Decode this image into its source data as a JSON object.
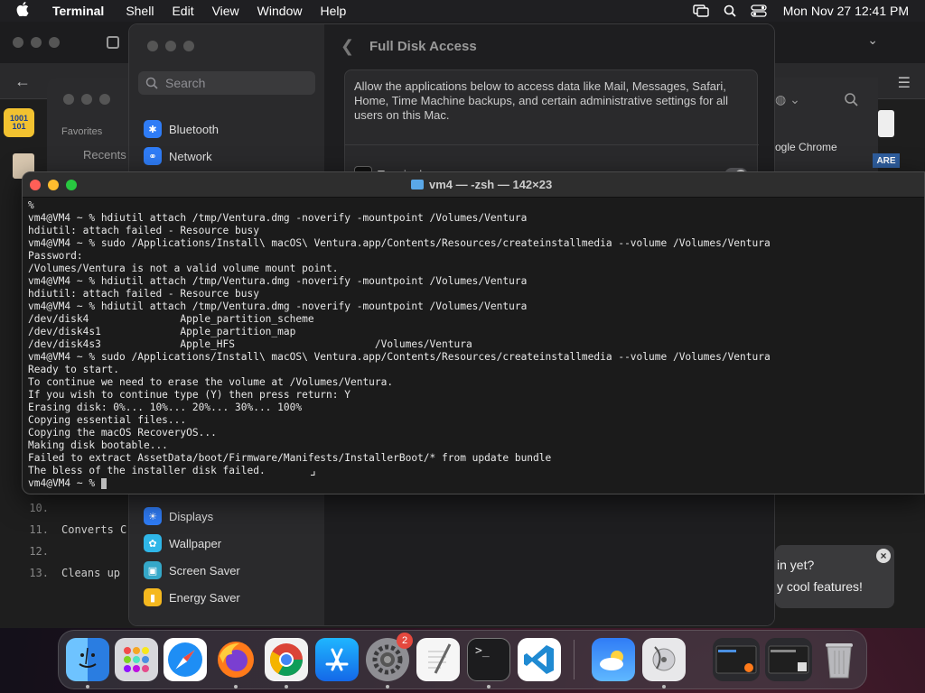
{
  "menubar": {
    "app_name": "Terminal",
    "menus": [
      "Shell",
      "Edit",
      "View",
      "Window",
      "Help"
    ],
    "clock": "Mon Nov 27  12:41 PM"
  },
  "settings": {
    "search_placeholder": "Search",
    "sidebar_items": [
      {
        "label": "Bluetooth",
        "color": "#2f7cf6"
      },
      {
        "label": "Network",
        "color": "#2f7cf6"
      },
      {
        "label": "Displays",
        "color": "#2f7cf6"
      },
      {
        "label": "Wallpaper",
        "color": "#2fb6e8"
      },
      {
        "label": "Screen Saver",
        "color": "#35a8c9"
      },
      {
        "label": "Energy Saver",
        "color": "#f5b81f"
      }
    ],
    "page_title": "Full Disk Access",
    "description": "Allow the applications below to access data like Mail, Messages, Safari, Home, Time Machine backups, and certain administrative settings for all users on this Mac.",
    "app_row_label": "Terminal",
    "app_row_enabled": true
  },
  "bg_window": {
    "favorites_label": "Favorites",
    "recents_label": "Recents",
    "chrome_label": "ogle Chrome",
    "are_label": "ARE",
    "code_lines": [
      {
        "num": "10.",
        "text": ""
      },
      {
        "num": "11.",
        "text": "Converts C"
      },
      {
        "num": "12.",
        "text": ""
      },
      {
        "num": "13.",
        "text": "Cleans up"
      }
    ],
    "notification_line1": "in yet?",
    "notification_line2": "y cool features!"
  },
  "terminal": {
    "title": "vm4 — -zsh — 142×23",
    "lines": [
      "%",
      "vm4@VM4 ~ % hdiutil attach /tmp/Ventura.dmg -noverify -mountpoint /Volumes/Ventura",
      "hdiutil: attach failed - Resource busy",
      "vm4@VM4 ~ % sudo /Applications/Install\\ macOS\\ Ventura.app/Contents/Resources/createinstallmedia --volume /Volumes/Ventura",
      "Password:",
      "/Volumes/Ventura is not a valid volume mount point.",
      "vm4@VM4 ~ % hdiutil attach /tmp/Ventura.dmg -noverify -mountpoint /Volumes/Ventura",
      "hdiutil: attach failed - Resource busy",
      "vm4@VM4 ~ % hdiutil attach /tmp/Ventura.dmg -noverify -mountpoint /Volumes/Ventura",
      "/dev/disk4               Apple_partition_scheme",
      "/dev/disk4s1             Apple_partition_map",
      "/dev/disk4s3             Apple_HFS                       /Volumes/Ventura",
      "vm4@VM4 ~ % sudo /Applications/Install\\ macOS\\ Ventura.app/Contents/Resources/createinstallmedia --volume /Volumes/Ventura",
      "Ready to start.",
      "To continue we need to erase the volume at /Volumes/Ventura.",
      "If you wish to continue type (Y) then press return: Y",
      "Erasing disk: 0%... 10%... 20%... 30%... 100%",
      "Copying essential files...",
      "Copying the macOS RecoveryOS...",
      "Making disk bootable...",
      "Failed to extract AssetData/boot/Firmware/Manifests/InstallerBoot/* from update bundle",
      "The bless of the installer disk failed.",
      "vm4@VM4 ~ % "
    ]
  },
  "dock": {
    "items": [
      {
        "name": "finder",
        "color": "#2c8cf0",
        "running": true
      },
      {
        "name": "launchpad",
        "color": "#d8d8dc",
        "running": false
      },
      {
        "name": "safari",
        "color": "#1e8ef5",
        "running": false
      },
      {
        "name": "firefox",
        "color": "#ff7a1a",
        "running": true
      },
      {
        "name": "chrome",
        "color": "#f2f2f2",
        "running": true
      },
      {
        "name": "app-store",
        "color": "#1c86f2",
        "running": false
      },
      {
        "name": "system-settings",
        "color": "#8e8e93",
        "running": true,
        "badge": "2"
      },
      {
        "name": "textedit",
        "color": "#f6f6f6",
        "running": false
      },
      {
        "name": "terminal",
        "color": "#1c1c1e",
        "running": true
      },
      {
        "name": "vscode",
        "color": "#ffffff",
        "running": false
      },
      {
        "name": "icloud-weather",
        "color": "#3d9df5",
        "running": false
      },
      {
        "name": "disk-utility",
        "color": "#e8e8ea",
        "running": true
      },
      {
        "name": "window-preview-1",
        "color": "#2a2a2e",
        "running": false
      },
      {
        "name": "window-preview-2",
        "color": "#2a2a2e",
        "running": false
      },
      {
        "name": "trash",
        "color": "#b8b8bc",
        "running": false
      }
    ]
  }
}
